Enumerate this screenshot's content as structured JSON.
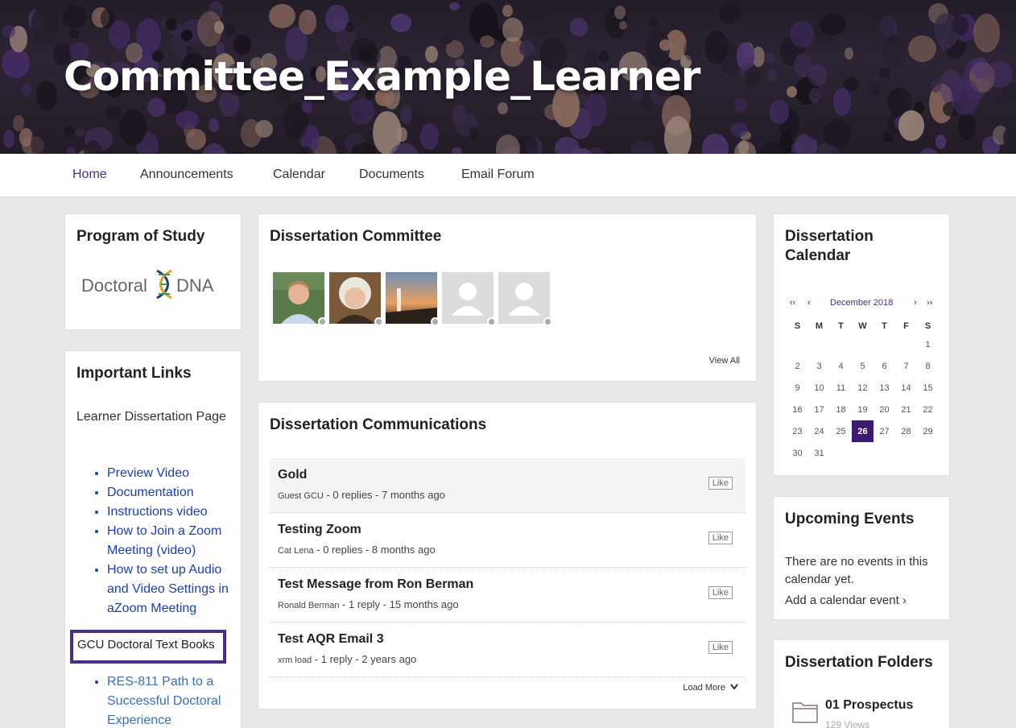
{
  "site": {
    "title": "Committee_Example_Learner"
  },
  "nav": [
    {
      "label": "Home",
      "active": true
    },
    {
      "label": "Announcements"
    },
    {
      "label": "Calendar"
    },
    {
      "label": "Documents"
    },
    {
      "label": "Email Forum"
    }
  ],
  "program": {
    "heading": "Program of Study",
    "logo_text_left": "Doctoral",
    "logo_text_right": "DNA"
  },
  "links": {
    "heading": "Important Links",
    "intro": "Learner Dissertation Page",
    "items": [
      "Preview Video",
      "Documentation",
      "Instructions video",
      "How to Join a Zoom Meeting (video)",
      "How to set up Audio and Video Settings in aZoom Meeting"
    ],
    "highlight": "GCU Doctoral Text Books",
    "items2": [
      "RES-811 Path to a Successful Doctoral Experience"
    ]
  },
  "committee": {
    "heading": "Dissertation Committee",
    "view_all": "View All"
  },
  "communications": {
    "heading": "Dissertation Communications",
    "like_label": "Like",
    "load_more": "Load More",
    "messages": [
      {
        "title": "Gold",
        "author": "Guest GCU",
        "replies": "0 replies",
        "time": "7 months ago"
      },
      {
        "title": "Testing Zoom",
        "author": "Cat Lena",
        "replies": "0 replies",
        "time": "8 months ago"
      },
      {
        "title": "Test Message from Ron Berman",
        "author": "Ronald Berman",
        "replies": "1 reply",
        "time": "15 months ago"
      },
      {
        "title": "Test AQR Email 3",
        "author": "xrm load",
        "replies": "1 reply",
        "time": "2 years ago"
      }
    ]
  },
  "calendar": {
    "heading": "Dissertation Calendar",
    "month": "December 2018",
    "nav_prev_year": "‹‹",
    "nav_prev": "‹",
    "nav_next": "›",
    "nav_next_year": "››",
    "weekdays": [
      "S",
      "M",
      "T",
      "W",
      "T",
      "F",
      "S"
    ],
    "weeks": [
      [
        "",
        "",
        "",
        "",
        "",
        "",
        "1"
      ],
      [
        "2",
        "3",
        "4",
        "5",
        "6",
        "7",
        "8"
      ],
      [
        "9",
        "10",
        "11",
        "12",
        "13",
        "14",
        "15"
      ],
      [
        "16",
        "17",
        "18",
        "19",
        "20",
        "21",
        "22"
      ],
      [
        "23",
        "24",
        "25",
        "26",
        "27",
        "28",
        "29"
      ],
      [
        "30",
        "31",
        "",
        "",
        "",
        "",
        ""
      ]
    ],
    "today": "26"
  },
  "events": {
    "heading": "Upcoming Events",
    "empty_text": "There are no events in this calendar yet.",
    "add_link": "Add a calendar event ›"
  },
  "folders": {
    "heading": "Dissertation Folders",
    "items": [
      {
        "name": "01 Prospectus",
        "views": "129 Views"
      }
    ]
  },
  "colors": {
    "accent": "#4b2e83",
    "link": "#1a3fb8",
    "today": "#3b1a70"
  }
}
